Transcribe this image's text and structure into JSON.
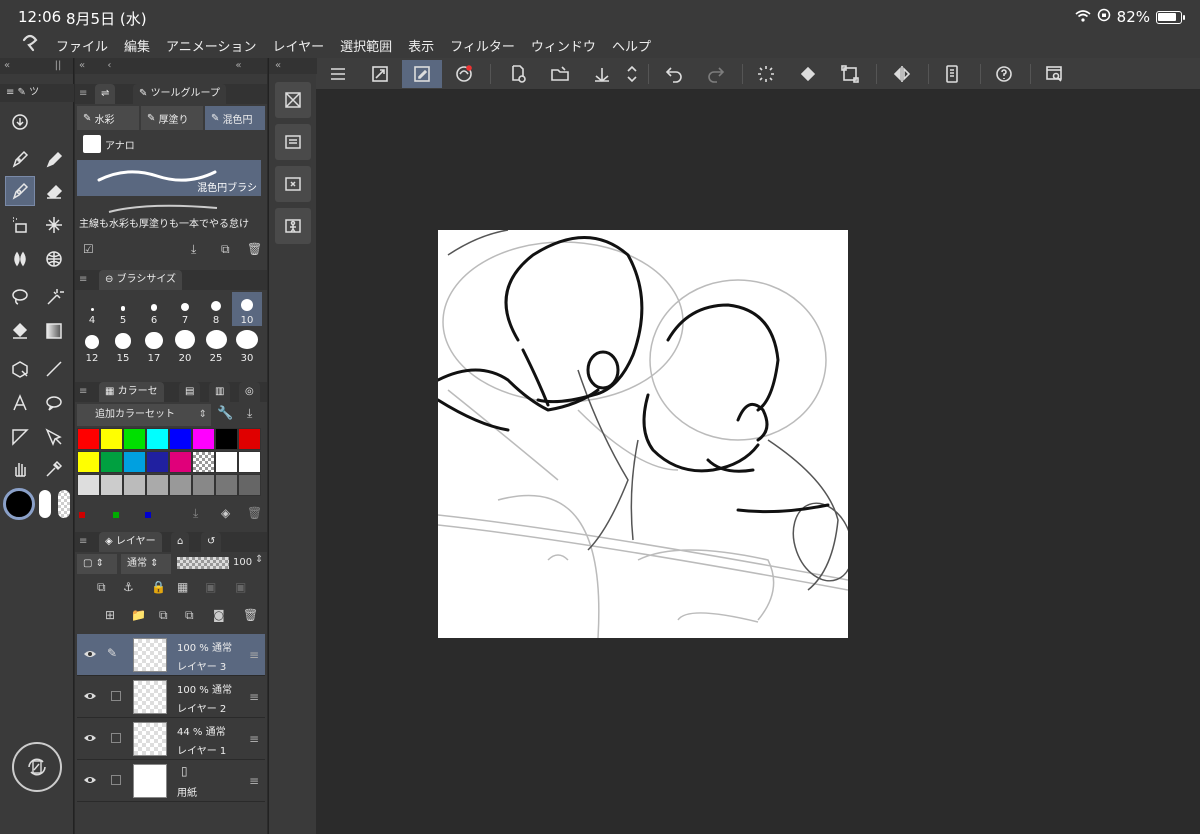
{
  "status": {
    "time": "12:06",
    "date": "8月5日 (水)",
    "battery": "82%",
    "battery_level": 0.82
  },
  "menu": [
    "ファイル",
    "編集",
    "アニメーション",
    "レイヤー",
    "選択範囲",
    "表示",
    "フィルター",
    "ウィンドウ",
    "ヘルプ"
  ],
  "tool_panel": {
    "title": "ツ"
  },
  "subtool": {
    "group_title": "ツールグループ",
    "tabs": [
      "水彩",
      "厚塗り",
      "混色円"
    ],
    "sub_item": "アナロ",
    "brushes": [
      {
        "name": "混色円ブラシ"
      },
      {
        "name": "主線も水彩も厚塗りも一本でやる怠け"
      }
    ]
  },
  "brush_size": {
    "title": "ブラシサイズ",
    "sizes": [
      "4",
      "5",
      "6",
      "7",
      "8",
      "10",
      "12",
      "15",
      "17",
      "20",
      "25",
      "30"
    ],
    "selected": "10"
  },
  "color_set": {
    "title": "カラーセ",
    "name": "追加カラーセット"
  },
  "layers": {
    "title": "レイヤー",
    "blend_mode": "通常",
    "opacity": "100",
    "items": [
      {
        "line1": "100 % 通常",
        "line2": "レイヤー 3",
        "active": true
      },
      {
        "line1": "100 % 通常",
        "line2": "レイヤー 2",
        "active": false
      },
      {
        "line1": "44 % 通常",
        "line2": "レイヤー 1",
        "active": false
      },
      {
        "line1": "",
        "line2": "用紙",
        "active": false
      }
    ]
  },
  "colors": {
    "accent": "#5a6880",
    "swatches_row1": [
      "#ff0000",
      "#ffff00",
      "#00e000",
      "#00ffff",
      "#0000ff",
      "#ff00ff",
      "#000000",
      "#e00000"
    ],
    "swatches_row2": [
      "#ffff00",
      "#00a040",
      "#00a0e0",
      "#2020a0",
      "#e0007a",
      "checker",
      "#ffffff",
      "#ffffff"
    ],
    "swatches_row3": [
      "#dddddd",
      "#cccccc",
      "#bbbbbb",
      "#aaaaaa",
      "#999999",
      "#888888",
      "#777777",
      "#666666"
    ]
  }
}
